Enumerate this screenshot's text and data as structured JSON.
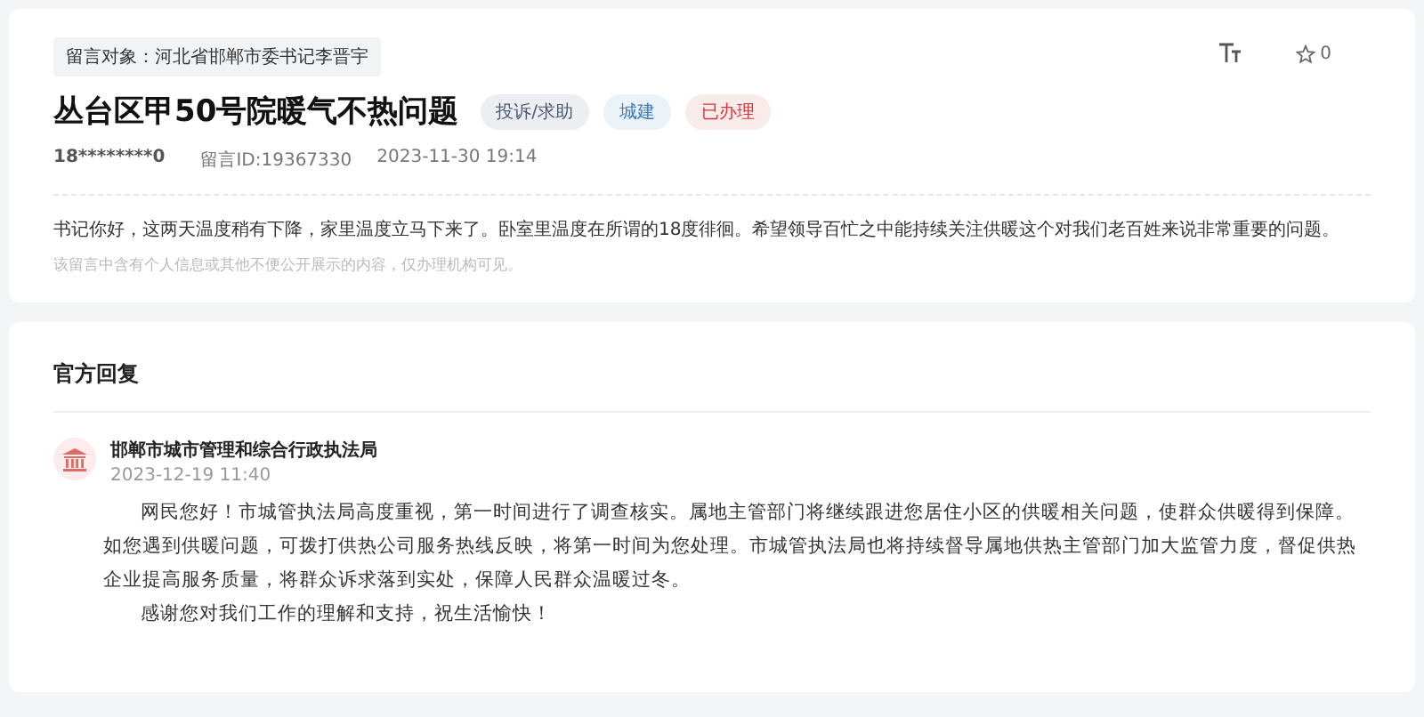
{
  "message": {
    "target": "留言对象：河北省邯郸市委书记李晋宇",
    "title": "丛台区甲50号院暖气不热问题",
    "tags": [
      {
        "label": "投诉/求助",
        "color": "#4a5a78"
      },
      {
        "label": "城建",
        "color": "#3a7bb8"
      },
      {
        "label": "已办理",
        "color": "#d0393e"
      }
    ],
    "favorites": "0",
    "author": "18********0",
    "id": "留言ID:19367330",
    "time": "2023-11-30 19:14",
    "body": "书记你好，这两天温度稍有下降，家里温度立马下来了。卧室里温度在所谓的18度徘徊。希望领导百忙之中能持续关注供暖这个对我们老百姓来说非常重要的问题。",
    "notice": "该留言中含有个人信息或其他不便公开展示的内容，仅办理机构可见。"
  },
  "reply": {
    "heading": "官方回复",
    "department": "邯郸市城市管理和综合行政执法局",
    "time": "2023-12-19 11:40",
    "paragraphs": [
      "网民您好！市城管执法局高度重视，第一时间进行了调查核实。属地主管部门将继续跟进您居住小区的供暖相关问题，使群众供暖得到保障。如您遇到供暖问题，可拨打供热公司服务热线反映，将第一时间为您处理。市城管执法局也将持续督导属地供热主管部门加大监管力度，督促供热企业提高服务质量，将群众诉求落到实处，保障人民群众温暖过冬。",
      "感谢您对我们工作的理解和支持，祝生活愉快！"
    ]
  }
}
